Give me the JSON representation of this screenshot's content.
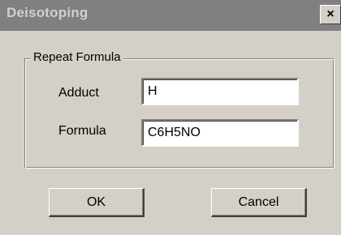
{
  "window": {
    "title": "Deisotoping",
    "close_label": "×"
  },
  "group": {
    "legend": "Repeat Formula"
  },
  "fields": {
    "adduct_label": "Adduct",
    "adduct_value": "H",
    "formula_label": "Formula",
    "formula_value": "C6H5NO"
  },
  "buttons": {
    "ok_label": "OK",
    "cancel_label": "Cancel"
  },
  "colors": {
    "face": "#d4d0c8",
    "titlebar_inactive": "#808080",
    "field_bg": "#ffffff"
  }
}
